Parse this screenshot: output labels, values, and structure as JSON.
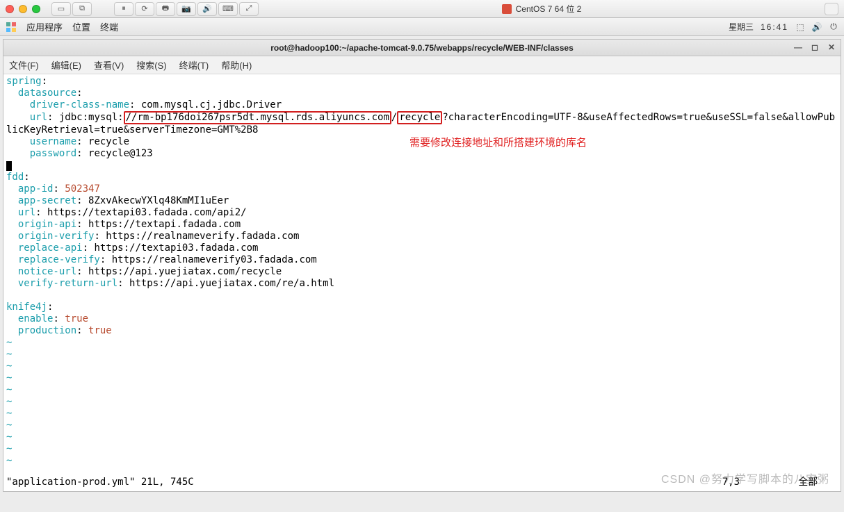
{
  "mac": {
    "vm_title": "CentOS 7 64 位 2"
  },
  "gnome": {
    "apps": "应用程序",
    "places": "位置",
    "terminal": "终端",
    "day": "星期三",
    "time": "16:41"
  },
  "term": {
    "title": "root@hadoop100:~/apache-tomcat-9.0.75/webapps/recycle/WEB-INF/classes",
    "menus": {
      "file": "文件(F)",
      "edit": "编辑(E)",
      "view": "查看(V)",
      "search": "搜索(S)",
      "terminal": "终端(T)",
      "help": "帮助(H)"
    }
  },
  "yaml": {
    "spring": "spring",
    "datasource": "datasource",
    "driver_class_name_key": "driver-class-name",
    "driver_class_name_val": "com.mysql.cj.jdbc.Driver",
    "url_key": "url",
    "url_prefix": "jdbc:mysql:",
    "url_host": "//rm-bp176doi267psr5dt.mysql.rds.aliyuncs.com",
    "url_slash": "/",
    "url_db": "recycle",
    "url_suffix": "?characterEncoding=UTF-8&useAffectedRows=true&useSSL=false&allowPub",
    "url_wrap": "licKeyRetrieval=true&serverTimezone=GMT%2B8",
    "username_key": "username",
    "username_val": "recycle",
    "password_key": "password",
    "password_val": "recycle@123",
    "fdd": "fdd",
    "app_id_key": "app-id",
    "app_id_val": "502347",
    "app_secret_key": "app-secret",
    "app_secret_val": "8ZxvAkecwYXlq48KmMI1uEer",
    "fdd_url_key": "url",
    "fdd_url_val": "https://textapi03.fadada.com/api2/",
    "origin_api_key": "origin-api",
    "origin_api_val": "https://textapi.fadada.com",
    "origin_verify_key": "origin-verify",
    "origin_verify_val": "https://realnameverify.fadada.com",
    "replace_api_key": "replace-api",
    "replace_api_val": "https://textapi03.fadada.com",
    "replace_verify_key": "replace-verify",
    "replace_verify_val": "https://realnameverify03.fadada.com",
    "notice_url_key": "notice-url",
    "notice_url_val": "https://api.yuejiatax.com/recycle",
    "verify_return_url_key": "verify-return-url",
    "verify_return_url_val": "https://api.yuejiatax.com/re/a.html",
    "knife4j": "knife4j",
    "enable_key": "enable",
    "enable_val": "true",
    "production_key": "production",
    "production_val": "true"
  },
  "annotation": "需要修改连接地址和所搭建环境的库名",
  "status": "\"application-prod.yml\" 21L, 745C",
  "status_right": "7,3          全部",
  "watermark": "CSDN @努力学写脚本的八宝粥"
}
